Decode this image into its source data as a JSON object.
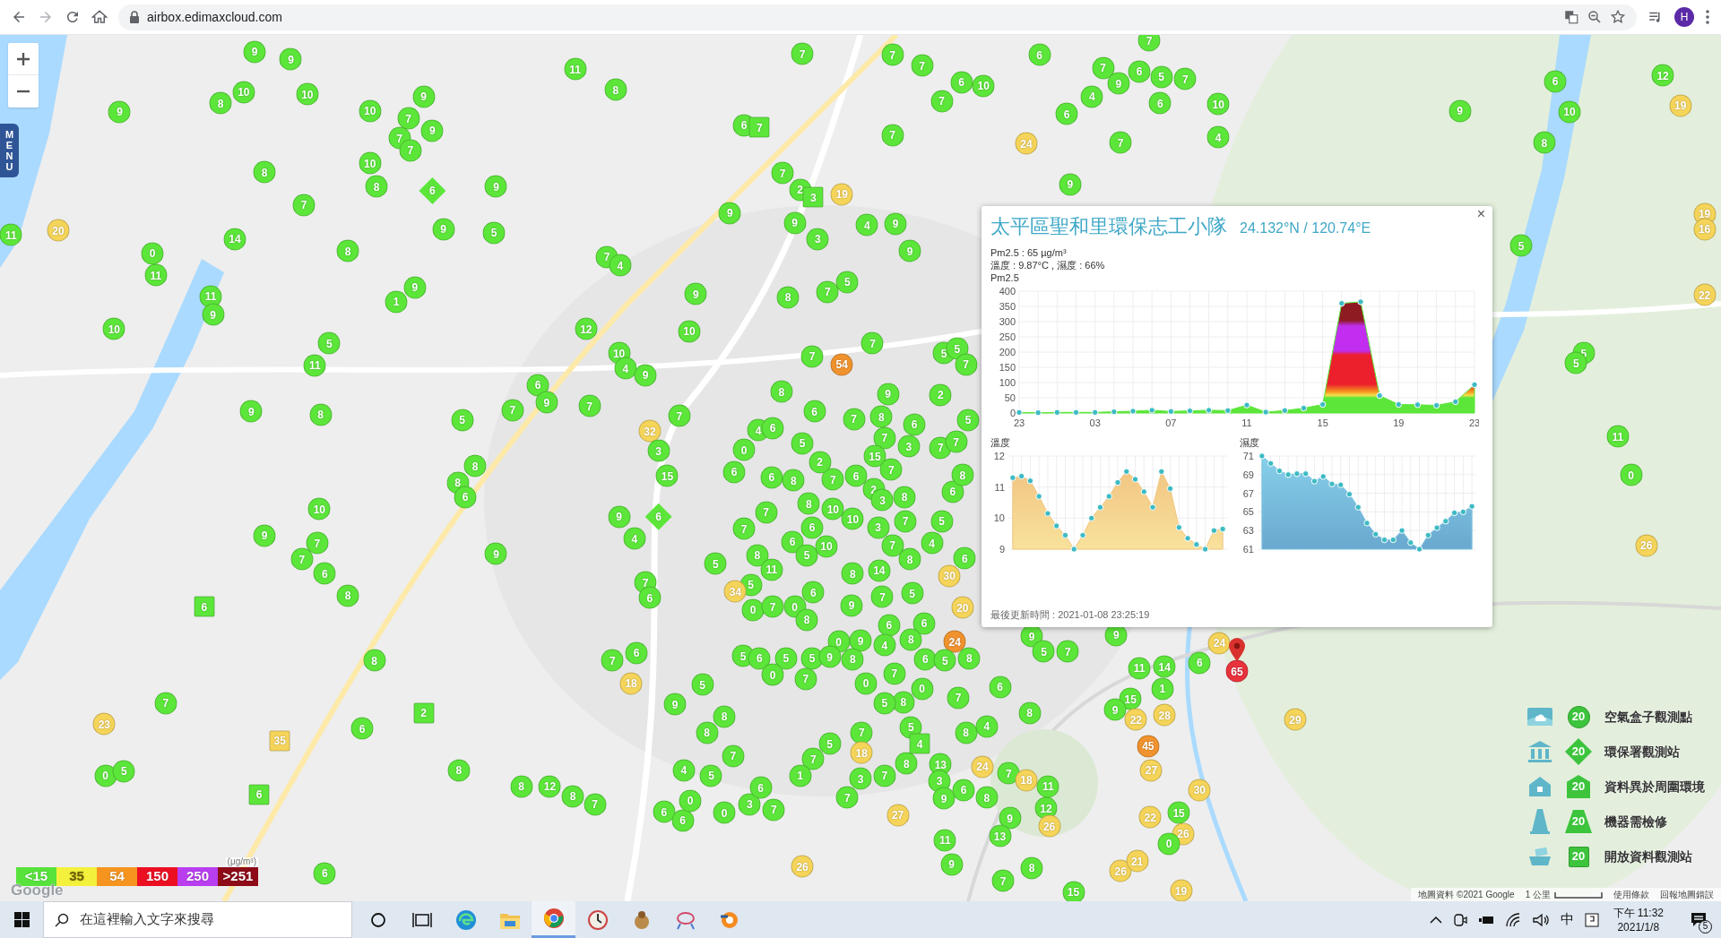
{
  "browser": {
    "url": "airbox.edimaxcloud.com",
    "avatar": "H"
  },
  "map": {
    "menu_tab": "MENU",
    "google_logo": "Google",
    "attribution": "地圖資料 ©2021 Google",
    "scale": "1 公里",
    "terms": "使用條款",
    "report": "回報地圖錯誤",
    "markers": [
      {
        "value": "9",
        "color": "#5ce63a",
        "kind": "circle"
      },
      {
        "value": "9",
        "color": "#5ce63a",
        "kind": "circle"
      },
      {
        "value": "10",
        "color": "#5ce63a",
        "kind": "circle"
      },
      {
        "value": "8",
        "color": "#5ce63a",
        "kind": "circle"
      },
      {
        "value": "10",
        "color": "#5ce63a",
        "kind": "circle"
      },
      {
        "value": "9",
        "color": "#5ce63a",
        "kind": "circle"
      },
      {
        "value": "10",
        "color": "#5ce63a",
        "kind": "circle"
      },
      {
        "value": "9",
        "color": "#5ce63a",
        "kind": "circle"
      },
      {
        "value": "7",
        "color": "#5ce63a",
        "kind": "circle"
      },
      {
        "value": "9",
        "color": "#5ce63a",
        "kind": "circle"
      },
      {
        "value": "7",
        "color": "#5ce63a",
        "kind": "circle"
      },
      {
        "value": "7",
        "color": "#5ce63a",
        "kind": "circle"
      },
      {
        "value": "11",
        "color": "#5ce63a",
        "kind": "circle"
      },
      {
        "value": "8",
        "color": "#5ce63a",
        "kind": "circle"
      },
      {
        "value": "10",
        "color": "#5ce63a",
        "kind": "circle"
      },
      {
        "value": "8",
        "color": "#5ce63a",
        "kind": "circle"
      },
      {
        "value": "8",
        "color": "#5ce63a",
        "kind": "circle"
      },
      {
        "value": "7",
        "color": "#5ce63a",
        "kind": "circle"
      },
      {
        "value": "6",
        "color": "#5ce63a",
        "kind": "diamond"
      },
      {
        "value": "9",
        "color": "#5ce63a",
        "kind": "circle"
      },
      {
        "value": "9",
        "color": "#5ce63a",
        "kind": "circle"
      },
      {
        "value": "5",
        "color": "#5ce63a",
        "kind": "circle"
      },
      {
        "value": "14",
        "color": "#5ce63a",
        "kind": "circle"
      },
      {
        "value": "11",
        "color": "#5ce63a",
        "kind": "circle"
      },
      {
        "value": "20",
        "color": "#f5d45a",
        "kind": "circle"
      },
      {
        "value": "0",
        "color": "#5ce63a",
        "kind": "circle"
      },
      {
        "value": "11",
        "color": "#5ce63a",
        "kind": "circle"
      },
      {
        "value": "8",
        "color": "#5ce63a",
        "kind": "circle"
      },
      {
        "value": "7",
        "color": "#5ce63a",
        "kind": "circle"
      },
      {
        "value": "4",
        "color": "#5ce63a",
        "kind": "circle"
      },
      {
        "value": "11",
        "color": "#5ce63a",
        "kind": "circle"
      },
      {
        "value": "9",
        "color": "#5ce63a",
        "kind": "circle"
      },
      {
        "value": "9",
        "color": "#5ce63a",
        "kind": "circle"
      },
      {
        "value": "1",
        "color": "#5ce63a",
        "kind": "circle"
      },
      {
        "value": "10",
        "color": "#5ce63a",
        "kind": "circle"
      },
      {
        "value": "12",
        "color": "#5ce63a",
        "kind": "circle"
      },
      {
        "value": "5",
        "color": "#5ce63a",
        "kind": "circle"
      },
      {
        "value": "11",
        "color": "#5ce63a",
        "kind": "circle"
      },
      {
        "value": "10",
        "color": "#5ce63a",
        "kind": "circle"
      },
      {
        "value": "4",
        "color": "#5ce63a",
        "kind": "circle"
      },
      {
        "value": "9",
        "color": "#5ce63a",
        "kind": "circle"
      },
      {
        "value": "10",
        "color": "#5ce63a",
        "kind": "circle"
      },
      {
        "value": "9",
        "color": "#5ce63a",
        "kind": "circle"
      },
      {
        "value": "6",
        "color": "#5ce63a",
        "kind": "circle"
      },
      {
        "value": "9",
        "color": "#5ce63a",
        "kind": "circle"
      },
      {
        "value": "7",
        "color": "#5ce63a",
        "kind": "circle"
      },
      {
        "value": "7",
        "color": "#5ce63a",
        "kind": "circle"
      },
      {
        "value": "9",
        "color": "#5ce63a",
        "kind": "circle"
      },
      {
        "value": "8",
        "color": "#5ce63a",
        "kind": "circle"
      },
      {
        "value": "5",
        "color": "#5ce63a",
        "kind": "circle"
      },
      {
        "value": "32",
        "color": "#f5d45a",
        "kind": "circle"
      },
      {
        "value": "3",
        "color": "#5ce63a",
        "kind": "circle"
      },
      {
        "value": "7",
        "color": "#5ce63a",
        "kind": "circle"
      },
      {
        "value": "8",
        "color": "#5ce63a",
        "kind": "circle"
      },
      {
        "value": "8",
        "color": "#5ce63a",
        "kind": "circle"
      },
      {
        "value": "6",
        "color": "#5ce63a",
        "kind": "circle"
      },
      {
        "value": "15",
        "color": "#5ce63a",
        "kind": "circle"
      },
      {
        "value": "10",
        "color": "#5ce63a",
        "kind": "circle"
      },
      {
        "value": "9",
        "color": "#5ce63a",
        "kind": "circle"
      },
      {
        "value": "7",
        "color": "#5ce63a",
        "kind": "circle"
      },
      {
        "value": "7",
        "color": "#5ce63a",
        "kind": "circle"
      },
      {
        "value": "6",
        "color": "#5ce63a",
        "kind": "circle"
      },
      {
        "value": "8",
        "color": "#5ce63a",
        "kind": "circle"
      },
      {
        "value": "9",
        "color": "#5ce63a",
        "kind": "circle"
      },
      {
        "value": "9",
        "color": "#5ce63a",
        "kind": "circle"
      },
      {
        "value": "4",
        "color": "#5ce63a",
        "kind": "circle"
      },
      {
        "value": "6",
        "color": "#5ce63a",
        "kind": "diamond"
      },
      {
        "value": "6",
        "color": "#5ce63a",
        "kind": "square"
      },
      {
        "value": "7",
        "color": "#5ce63a",
        "kind": "circle"
      },
      {
        "value": "6",
        "color": "#5ce63a",
        "kind": "circle"
      },
      {
        "value": "8",
        "color": "#5ce63a",
        "kind": "circle"
      },
      {
        "value": "7",
        "color": "#5ce63a",
        "kind": "circle"
      },
      {
        "value": "6",
        "color": "#5ce63a",
        "kind": "circle"
      },
      {
        "value": "18",
        "color": "#f5d45a",
        "kind": "circle"
      },
      {
        "value": "7",
        "color": "#5ce63a",
        "kind": "circle"
      },
      {
        "value": "23",
        "color": "#f5d45a",
        "kind": "circle"
      },
      {
        "value": "6",
        "color": "#5ce63a",
        "kind": "circle"
      },
      {
        "value": "2",
        "color": "#5ce63a",
        "kind": "square"
      },
      {
        "value": "35",
        "color": "#f5d45a",
        "kind": "square"
      },
      {
        "value": "8",
        "color": "#5ce63a",
        "kind": "circle"
      },
      {
        "value": "0",
        "color": "#5ce63a",
        "kind": "circle"
      },
      {
        "value": "5",
        "color": "#5ce63a",
        "kind": "circle"
      },
      {
        "value": "6",
        "color": "#5ce63a",
        "kind": "square"
      },
      {
        "value": "8",
        "color": "#5ce63a",
        "kind": "circle"
      },
      {
        "value": "12",
        "color": "#5ce63a",
        "kind": "circle"
      },
      {
        "value": "8",
        "color": "#5ce63a",
        "kind": "circle"
      },
      {
        "value": "7",
        "color": "#5ce63a",
        "kind": "circle"
      },
      {
        "value": "6",
        "color": "#5ce63a",
        "kind": "circle"
      },
      {
        "value": "9",
        "color": "#5ce63a",
        "kind": "circle"
      },
      {
        "value": "5",
        "color": "#5ce63a",
        "kind": "circle"
      },
      {
        "value": "8",
        "color": "#5ce63a",
        "kind": "circle"
      },
      {
        "value": "8",
        "color": "#5ce63a",
        "kind": "circle"
      },
      {
        "value": "4",
        "color": "#5ce63a",
        "kind": "circle"
      },
      {
        "value": "5",
        "color": "#5ce63a",
        "kind": "circle"
      },
      {
        "value": "7",
        "color": "#5ce63a",
        "kind": "circle"
      },
      {
        "value": "6",
        "color": "#5ce63a",
        "kind": "circle"
      },
      {
        "value": "6",
        "color": "#5ce63a",
        "kind": "circle"
      },
      {
        "value": "0",
        "color": "#5ce63a",
        "kind": "circle"
      },
      {
        "value": "0",
        "color": "#5ce63a",
        "kind": "circle"
      },
      {
        "value": "3",
        "color": "#5ce63a",
        "kind": "circle"
      },
      {
        "value": "7",
        "color": "#5ce63a",
        "kind": "circle"
      },
      {
        "value": "6",
        "color": "#5ce63a",
        "kind": "circle"
      },
      {
        "value": "26",
        "color": "#f5d45a",
        "kind": "circle"
      },
      {
        "value": "9",
        "color": "#5ce63a",
        "kind": "circle"
      },
      {
        "value": "7",
        "color": "#5ce63a",
        "kind": "circle"
      },
      {
        "value": "8",
        "color": "#5ce63a",
        "kind": "circle"
      },
      {
        "value": "15",
        "color": "#5ce63a",
        "kind": "circle"
      },
      {
        "value": "26",
        "color": "#f5d45a",
        "kind": "circle"
      },
      {
        "value": "19",
        "color": "#f5d45a",
        "kind": "circle"
      },
      {
        "value": "7",
        "color": "#5ce63a",
        "kind": "circle"
      },
      {
        "value": "7",
        "color": "#5ce63a",
        "kind": "circle"
      },
      {
        "value": "7",
        "color": "#5ce63a",
        "kind": "circle"
      },
      {
        "value": "6",
        "color": "#5ce63a",
        "kind": "circle"
      },
      {
        "value": "10",
        "color": "#5ce63a",
        "kind": "circle"
      },
      {
        "value": "7",
        "color": "#5ce63a",
        "kind": "circle"
      },
      {
        "value": "6",
        "color": "#5ce63a",
        "kind": "circle"
      },
      {
        "value": "7",
        "color": "#5ce63a",
        "kind": "circle"
      },
      {
        "value": "7",
        "color": "#5ce63a",
        "kind": "circle"
      },
      {
        "value": "9",
        "color": "#5ce63a",
        "kind": "circle"
      },
      {
        "value": "6",
        "color": "#5ce63a",
        "kind": "circle"
      },
      {
        "value": "5",
        "color": "#5ce63a",
        "kind": "circle"
      },
      {
        "value": "7",
        "color": "#5ce63a",
        "kind": "circle"
      },
      {
        "value": "4",
        "color": "#5ce63a",
        "kind": "circle"
      },
      {
        "value": "6",
        "color": "#5ce63a",
        "kind": "circle"
      },
      {
        "value": "6",
        "color": "#5ce63a",
        "kind": "circle"
      },
      {
        "value": "10",
        "color": "#5ce63a",
        "kind": "circle"
      },
      {
        "value": "4",
        "color": "#5ce63a",
        "kind": "circle"
      },
      {
        "value": "24",
        "color": "#f5d45a",
        "kind": "circle"
      },
      {
        "value": "7",
        "color": "#5ce63a",
        "kind": "circle"
      },
      {
        "value": "9",
        "color": "#5ce63a",
        "kind": "circle"
      },
      {
        "value": "7",
        "color": "#5ce63a",
        "kind": "circle"
      },
      {
        "value": "6",
        "color": "#5ce63a",
        "kind": "circle"
      },
      {
        "value": "7",
        "color": "#5ce63a",
        "kind": "square"
      },
      {
        "value": "7",
        "color": "#5ce63a",
        "kind": "circle"
      },
      {
        "value": "2",
        "color": "#5ce63a",
        "kind": "circle"
      },
      {
        "value": "19",
        "color": "#f5d45a",
        "kind": "circle"
      },
      {
        "value": "3",
        "color": "#5ce63a",
        "kind": "square"
      },
      {
        "value": "9",
        "color": "#5ce63a",
        "kind": "circle"
      },
      {
        "value": "9",
        "color": "#5ce63a",
        "kind": "circle"
      },
      {
        "value": "3",
        "color": "#5ce63a",
        "kind": "circle"
      },
      {
        "value": "4",
        "color": "#5ce63a",
        "kind": "circle"
      },
      {
        "value": "9",
        "color": "#5ce63a",
        "kind": "circle"
      },
      {
        "value": "9",
        "color": "#5ce63a",
        "kind": "circle"
      },
      {
        "value": "5",
        "color": "#5ce63a",
        "kind": "circle"
      },
      {
        "value": "7",
        "color": "#5ce63a",
        "kind": "circle"
      },
      {
        "value": "8",
        "color": "#5ce63a",
        "kind": "circle"
      },
      {
        "value": "54",
        "color": "#f0932e",
        "kind": "circle"
      },
      {
        "value": "7",
        "color": "#5ce63a",
        "kind": "circle"
      },
      {
        "value": "7",
        "color": "#5ce63a",
        "kind": "circle"
      },
      {
        "value": "8",
        "color": "#5ce63a",
        "kind": "circle"
      },
      {
        "value": "9",
        "color": "#5ce63a",
        "kind": "circle"
      },
      {
        "value": "7",
        "color": "#5ce63a",
        "kind": "circle"
      },
      {
        "value": "8",
        "color": "#5ce63a",
        "kind": "circle"
      },
      {
        "value": "6",
        "color": "#5ce63a",
        "kind": "circle"
      },
      {
        "value": "5",
        "color": "#5ce63a",
        "kind": "circle"
      },
      {
        "value": "5",
        "color": "#5ce63a",
        "kind": "circle"
      },
      {
        "value": "7",
        "color": "#5ce63a",
        "kind": "circle"
      },
      {
        "value": "5",
        "color": "#5ce63a",
        "kind": "circle"
      },
      {
        "value": "2",
        "color": "#5ce63a",
        "kind": "circle"
      },
      {
        "value": "0",
        "color": "#5ce63a",
        "kind": "circle"
      },
      {
        "value": "4",
        "color": "#5ce63a",
        "kind": "circle"
      },
      {
        "value": "6",
        "color": "#5ce63a",
        "kind": "circle"
      },
      {
        "value": "6",
        "color": "#5ce63a",
        "kind": "circle"
      },
      {
        "value": "5",
        "color": "#5ce63a",
        "kind": "circle"
      },
      {
        "value": "6",
        "color": "#5ce63a",
        "kind": "circle"
      },
      {
        "value": "6",
        "color": "#5ce63a",
        "kind": "circle"
      },
      {
        "value": "8",
        "color": "#5ce63a",
        "kind": "circle"
      },
      {
        "value": "7",
        "color": "#5ce63a",
        "kind": "circle"
      },
      {
        "value": "6",
        "color": "#5ce63a",
        "kind": "circle"
      },
      {
        "value": "7",
        "color": "#5ce63a",
        "kind": "circle"
      },
      {
        "value": "3",
        "color": "#5ce63a",
        "kind": "circle"
      },
      {
        "value": "15",
        "color": "#5ce63a",
        "kind": "circle"
      },
      {
        "value": "7",
        "color": "#5ce63a",
        "kind": "circle"
      },
      {
        "value": "7",
        "color": "#5ce63a",
        "kind": "circle"
      },
      {
        "value": "7",
        "color": "#5ce63a",
        "kind": "circle"
      },
      {
        "value": "2",
        "color": "#5ce63a",
        "kind": "circle"
      },
      {
        "value": "2",
        "color": "#5ce63a",
        "kind": "circle"
      },
      {
        "value": "8",
        "color": "#5ce63a",
        "kind": "circle"
      },
      {
        "value": "3",
        "color": "#5ce63a",
        "kind": "circle"
      },
      {
        "value": "8",
        "color": "#5ce63a",
        "kind": "circle"
      },
      {
        "value": "10",
        "color": "#5ce63a",
        "kind": "circle"
      },
      {
        "value": "10",
        "color": "#5ce63a",
        "kind": "circle"
      },
      {
        "value": "3",
        "color": "#5ce63a",
        "kind": "circle"
      },
      {
        "value": "7",
        "color": "#5ce63a",
        "kind": "circle"
      },
      {
        "value": "7",
        "color": "#5ce63a",
        "kind": "circle"
      },
      {
        "value": "6",
        "color": "#5ce63a",
        "kind": "circle"
      },
      {
        "value": "6",
        "color": "#5ce63a",
        "kind": "circle"
      },
      {
        "value": "4",
        "color": "#5ce63a",
        "kind": "circle"
      },
      {
        "value": "7",
        "color": "#5ce63a",
        "kind": "circle"
      },
      {
        "value": "6",
        "color": "#5ce63a",
        "kind": "circle"
      },
      {
        "value": "8",
        "color": "#5ce63a",
        "kind": "circle"
      },
      {
        "value": "6",
        "color": "#5ce63a",
        "kind": "circle"
      },
      {
        "value": "5",
        "color": "#5ce63a",
        "kind": "circle"
      },
      {
        "value": "8",
        "color": "#5ce63a",
        "kind": "circle"
      },
      {
        "value": "5",
        "color": "#5ce63a",
        "kind": "circle"
      },
      {
        "value": "10",
        "color": "#5ce63a",
        "kind": "circle"
      },
      {
        "value": "7",
        "color": "#5ce63a",
        "kind": "circle"
      },
      {
        "value": "8",
        "color": "#5ce63a",
        "kind": "circle"
      },
      {
        "value": "14",
        "color": "#5ce63a",
        "kind": "circle"
      },
      {
        "value": "8",
        "color": "#5ce63a",
        "kind": "circle"
      },
      {
        "value": "30",
        "color": "#f5d45a",
        "kind": "circle"
      },
      {
        "value": "5",
        "color": "#5ce63a",
        "kind": "circle"
      },
      {
        "value": "11",
        "color": "#5ce63a",
        "kind": "circle"
      },
      {
        "value": "5",
        "color": "#5ce63a",
        "kind": "circle"
      },
      {
        "value": "34",
        "color": "#f5d45a",
        "kind": "circle"
      },
      {
        "value": "6",
        "color": "#5ce63a",
        "kind": "circle"
      },
      {
        "value": "0",
        "color": "#5ce63a",
        "kind": "circle"
      },
      {
        "value": "7",
        "color": "#5ce63a",
        "kind": "circle"
      },
      {
        "value": "0",
        "color": "#5ce63a",
        "kind": "circle"
      },
      {
        "value": "7",
        "color": "#5ce63a",
        "kind": "circle"
      },
      {
        "value": "5",
        "color": "#5ce63a",
        "kind": "circle"
      },
      {
        "value": "9",
        "color": "#5ce63a",
        "kind": "circle"
      },
      {
        "value": "20",
        "color": "#f5d45a",
        "kind": "circle"
      },
      {
        "value": "8",
        "color": "#5ce63a",
        "kind": "circle"
      },
      {
        "value": "6",
        "color": "#5ce63a",
        "kind": "circle"
      },
      {
        "value": "6",
        "color": "#5ce63a",
        "kind": "circle"
      },
      {
        "value": "0",
        "color": "#5ce63a",
        "kind": "circle"
      },
      {
        "value": "9",
        "color": "#5ce63a",
        "kind": "circle"
      },
      {
        "value": "4",
        "color": "#5ce63a",
        "kind": "circle"
      },
      {
        "value": "8",
        "color": "#5ce63a",
        "kind": "circle"
      },
      {
        "value": "24",
        "color": "#f0932e",
        "kind": "circle"
      },
      {
        "value": "5",
        "color": "#5ce63a",
        "kind": "circle"
      },
      {
        "value": "6",
        "color": "#5ce63a",
        "kind": "circle"
      },
      {
        "value": "5",
        "color": "#5ce63a",
        "kind": "circle"
      },
      {
        "value": "5",
        "color": "#5ce63a",
        "kind": "circle"
      },
      {
        "value": "9",
        "color": "#5ce63a",
        "kind": "circle"
      },
      {
        "value": "8",
        "color": "#5ce63a",
        "kind": "circle"
      },
      {
        "value": "6",
        "color": "#5ce63a",
        "kind": "circle"
      },
      {
        "value": "5",
        "color": "#5ce63a",
        "kind": "circle"
      },
      {
        "value": "8",
        "color": "#5ce63a",
        "kind": "circle"
      },
      {
        "value": "0",
        "color": "#5ce63a",
        "kind": "circle"
      },
      {
        "value": "7",
        "color": "#5ce63a",
        "kind": "circle"
      },
      {
        "value": "0",
        "color": "#5ce63a",
        "kind": "circle"
      },
      {
        "value": "7",
        "color": "#5ce63a",
        "kind": "circle"
      },
      {
        "value": "0",
        "color": "#5ce63a",
        "kind": "circle"
      },
      {
        "value": "8",
        "color": "#5ce63a",
        "kind": "circle"
      },
      {
        "value": "7",
        "color": "#5ce63a",
        "kind": "circle"
      },
      {
        "value": "5",
        "color": "#5ce63a",
        "kind": "circle"
      },
      {
        "value": "6",
        "color": "#5ce63a",
        "kind": "circle"
      },
      {
        "value": "8",
        "color": "#5ce63a",
        "kind": "circle"
      },
      {
        "value": "8",
        "color": "#5ce63a",
        "kind": "circle"
      },
      {
        "value": "4",
        "color": "#5ce63a",
        "kind": "circle"
      },
      {
        "value": "5",
        "color": "#5ce63a",
        "kind": "circle"
      },
      {
        "value": "7",
        "color": "#5ce63a",
        "kind": "circle"
      },
      {
        "value": "5",
        "color": "#5ce63a",
        "kind": "circle"
      },
      {
        "value": "4",
        "color": "#5ce63a",
        "kind": "square"
      },
      {
        "value": "18",
        "color": "#f5d45a",
        "kind": "circle"
      },
      {
        "value": "7",
        "color": "#5ce63a",
        "kind": "circle"
      },
      {
        "value": "1",
        "color": "#5ce63a",
        "kind": "circle"
      },
      {
        "value": "3",
        "color": "#5ce63a",
        "kind": "circle"
      },
      {
        "value": "7",
        "color": "#5ce63a",
        "kind": "circle"
      },
      {
        "value": "8",
        "color": "#5ce63a",
        "kind": "circle"
      },
      {
        "value": "13",
        "color": "#5ce63a",
        "kind": "circle"
      },
      {
        "value": "24",
        "color": "#f5d45a",
        "kind": "circle"
      },
      {
        "value": "7",
        "color": "#5ce63a",
        "kind": "circle"
      },
      {
        "value": "3",
        "color": "#5ce63a",
        "kind": "circle"
      },
      {
        "value": "18",
        "color": "#f5d45a",
        "kind": "circle"
      },
      {
        "value": "6",
        "color": "#5ce63a",
        "kind": "circle"
      },
      {
        "value": "7",
        "color": "#5ce63a",
        "kind": "circle"
      },
      {
        "value": "9",
        "color": "#5ce63a",
        "kind": "circle"
      },
      {
        "value": "8",
        "color": "#5ce63a",
        "kind": "circle"
      },
      {
        "value": "9",
        "color": "#5ce63a",
        "kind": "circle"
      },
      {
        "value": "27",
        "color": "#f5d45a",
        "kind": "circle"
      },
      {
        "value": "11",
        "color": "#5ce63a",
        "kind": "circle"
      },
      {
        "value": "12",
        "color": "#5ce63a",
        "kind": "circle"
      },
      {
        "value": "26",
        "color": "#f5d45a",
        "kind": "circle"
      },
      {
        "value": "13",
        "color": "#5ce63a",
        "kind": "circle"
      },
      {
        "value": "11",
        "color": "#5ce63a",
        "kind": "circle"
      },
      {
        "value": "9",
        "color": "#5ce63a",
        "kind": "circle"
      },
      {
        "value": "5",
        "color": "#5ce63a",
        "kind": "circle"
      },
      {
        "value": "7",
        "color": "#5ce63a",
        "kind": "circle"
      },
      {
        "value": "9",
        "color": "#5ce63a",
        "kind": "circle"
      },
      {
        "value": "11",
        "color": "#5ce63a",
        "kind": "circle"
      },
      {
        "value": "14",
        "color": "#5ce63a",
        "kind": "circle"
      },
      {
        "value": "6",
        "color": "#5ce63a",
        "kind": "circle"
      },
      {
        "value": "24",
        "color": "#f5d45a",
        "kind": "circle"
      },
      {
        "value": "15",
        "color": "#5ce63a",
        "kind": "circle"
      },
      {
        "value": "1",
        "color": "#5ce63a",
        "kind": "circle"
      },
      {
        "value": "9",
        "color": "#5ce63a",
        "kind": "circle"
      },
      {
        "value": "22",
        "color": "#f5d45a",
        "kind": "circle"
      },
      {
        "value": "28",
        "color": "#f5d45a",
        "kind": "circle"
      },
      {
        "value": "45",
        "color": "#f0932e",
        "kind": "circle"
      },
      {
        "value": "27",
        "color": "#f5d45a",
        "kind": "circle"
      },
      {
        "value": "30",
        "color": "#f5d45a",
        "kind": "circle"
      },
      {
        "value": "15",
        "color": "#5ce63a",
        "kind": "circle"
      },
      {
        "value": "22",
        "color": "#f5d45a",
        "kind": "circle"
      },
      {
        "value": "26",
        "color": "#f5d45a",
        "kind": "circle"
      },
      {
        "value": "0",
        "color": "#5ce63a",
        "kind": "circle"
      },
      {
        "value": "21",
        "color": "#f5d45a",
        "kind": "circle"
      },
      {
        "value": "29",
        "color": "#f5d45a",
        "kind": "circle"
      },
      {
        "value": "6",
        "color": "#5ce63a",
        "kind": "circle"
      },
      {
        "value": "12",
        "color": "#5ce63a",
        "kind": "circle"
      },
      {
        "value": "19",
        "color": "#f5d45a",
        "kind": "circle"
      },
      {
        "value": "9",
        "color": "#5ce63a",
        "kind": "circle"
      },
      {
        "value": "10",
        "color": "#5ce63a",
        "kind": "circle"
      },
      {
        "value": "8",
        "color": "#5ce63a",
        "kind": "circle"
      },
      {
        "value": "19",
        "color": "#f5d45a",
        "kind": "circle"
      },
      {
        "value": "16",
        "color": "#f5d45a",
        "kind": "circle"
      },
      {
        "value": "5",
        "color": "#5ce63a",
        "kind": "circle"
      },
      {
        "value": "22",
        "color": "#f5d45a",
        "kind": "circle"
      },
      {
        "value": "5",
        "color": "#5ce63a",
        "kind": "circle"
      },
      {
        "value": "5",
        "color": "#5ce63a",
        "kind": "circle"
      },
      {
        "value": "11",
        "color": "#5ce63a",
        "kind": "circle"
      },
      {
        "value": "0",
        "color": "#5ce63a",
        "kind": "circle"
      },
      {
        "value": "26",
        "color": "#f5d45a",
        "kind": "circle"
      },
      {
        "value": "65",
        "color": "#e8323c",
        "kind": "pin"
      }
    ]
  },
  "popup": {
    "title": "太平區聖和里環保志工小隊",
    "coordinates": "24.132°N / 120.74°E",
    "close": "×",
    "pm25": "Pm2.5 : 65 µg/m³",
    "climate": "溫度 : 9.87°C , 濕度 : 66%",
    "updated": "最後更新時間 : 2021-01-08 23:25:19",
    "pm25_chart": {
      "chart_data": {
        "type": "area",
        "grid": true,
        "categories": [
          "23",
          null,
          null,
          null,
          "03",
          null,
          null,
          null,
          "07",
          null,
          null,
          null,
          "11",
          null,
          null,
          null,
          "15",
          null,
          null,
          null,
          "19",
          null,
          null,
          null,
          "23"
        ],
        "series": [
          {
            "name": "Pm2.5",
            "color": "#5ce63a",
            "values": [
              2,
              1,
              2,
              2,
              2,
              4,
              6,
              9,
              5,
              7,
              9,
              8,
              26,
              3,
              8,
              16,
              28,
              360,
              365,
              57,
              28,
              27,
              25,
              37,
              93
            ]
          }
        ],
        "ylim": [
          0,
          400
        ],
        "yticks": [
          0,
          50,
          100,
          150,
          200,
          250,
          300,
          350,
          400
        ]
      }
    },
    "temperature_chart": {
      "label": "溫度",
      "y_labels": [
        "12",
        "11",
        "10",
        "9"
      ]
    },
    "humidity_chart": {
      "label": "濕度",
      "y_labels": [
        "71",
        "69",
        "67",
        "65",
        "63",
        "61"
      ]
    }
  },
  "aqi_legend": {
    "unit": "(μg/m³)",
    "levels": [
      {
        "label": "<15",
        "color": "#57e23c"
      },
      {
        "label": "35",
        "color": "#f4f13c"
      },
      {
        "label": "54",
        "color": "#f5951f"
      },
      {
        "label": "150",
        "color": "#ec0f22"
      },
      {
        "label": "250",
        "color": "#b83ef0"
      },
      {
        "label": ">251",
        "color": "#8e0b18"
      }
    ]
  },
  "marker_legend": [
    {
      "kind": "circle",
      "value": "20",
      "label": "空氣盒子觀測點"
    },
    {
      "kind": "diamond",
      "value": "20",
      "label": "環保署觀測站"
    },
    {
      "kind": "house",
      "value": "20",
      "label": "資料異於周圍環境"
    },
    {
      "kind": "cone",
      "value": "20",
      "label": "機器需檢修"
    },
    {
      "kind": "square",
      "value": "20",
      "label": "開放資料觀測站"
    }
  ],
  "taskbar": {
    "search_placeholder": "在這裡輸入文字來搜尋",
    "ime": "中",
    "time": "下午 11:32",
    "date": "2021/1/8",
    "notifications": "5"
  }
}
